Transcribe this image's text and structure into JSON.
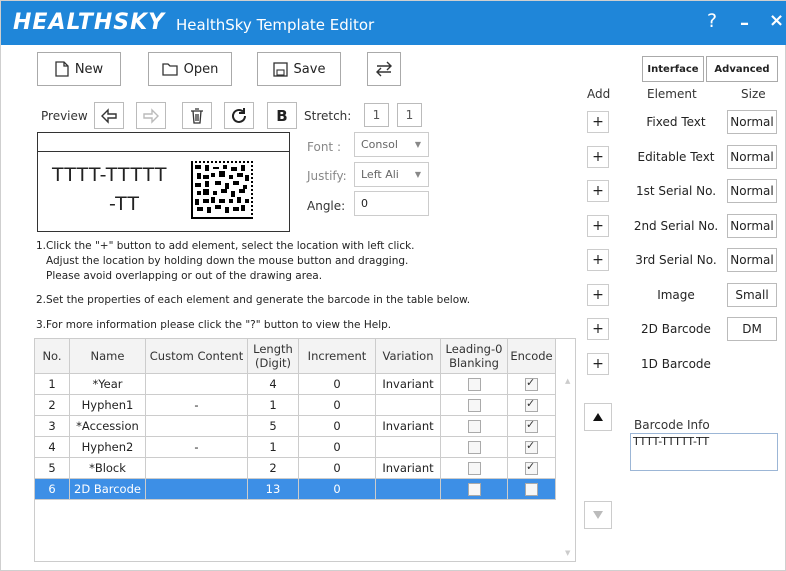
{
  "title": {
    "logo": "HEALTHSKY",
    "app": "HealthSky Template Editor",
    "help": "?",
    "minimize": "–",
    "close": "×"
  },
  "toolbar": {
    "new": "New",
    "open": "Open",
    "save": "Save"
  },
  "preview": {
    "label": "Preview",
    "bold": "B",
    "stretch_label": "Stretch:",
    "stretch_x": "1",
    "stretch_y": "1",
    "font_label": "Font :",
    "font_value": "Consol",
    "justify_label": "Justify:",
    "justify_value": "Left Ali",
    "angle_label": "Angle:",
    "angle_value": "0",
    "text_line1": "TTTT-TTTTT",
    "text_line2": "-TT"
  },
  "instructions": [
    "1.Click the \"+\" button to add element, select the location with left click.",
    "Adjust the location by holding down the mouse button and dragging.",
    "Please avoid overlapping or out of the drawing area.",
    "2.Set the properties of each element and generate the barcode in the table below.",
    "3.For more information please click the \"?\" button to view the Help."
  ],
  "table": {
    "headers": {
      "no": "No.",
      "name": "Name",
      "custom": "Custom Content",
      "length": "Length (Digit)",
      "increment": "Increment",
      "variation": "Variation",
      "leading": "Leading-0 Blanking",
      "encode": "Encode"
    },
    "rows": [
      {
        "no": "1",
        "name": "*Year",
        "custom": "",
        "length": "4",
        "increment": "0",
        "variation": "Invariant",
        "leading": false,
        "encode": true
      },
      {
        "no": "2",
        "name": "Hyphen1",
        "custom": "-",
        "length": "1",
        "increment": "0",
        "variation": "",
        "leading": false,
        "encode": true
      },
      {
        "no": "3",
        "name": "*Accession",
        "custom": "",
        "length": "5",
        "increment": "0",
        "variation": "Invariant",
        "leading": false,
        "encode": true
      },
      {
        "no": "4",
        "name": "Hyphen2",
        "custom": "-",
        "length": "1",
        "increment": "0",
        "variation": "",
        "leading": false,
        "encode": true
      },
      {
        "no": "5",
        "name": "*Block",
        "custom": "",
        "length": "2",
        "increment": "0",
        "variation": "Invariant",
        "leading": false,
        "encode": true
      },
      {
        "no": "6",
        "name": "2D Barcode",
        "custom": "",
        "length": "13",
        "increment": "0",
        "variation": "",
        "leading": false,
        "encode": false
      }
    ],
    "selected_row": "6"
  },
  "right": {
    "interface": "Interface",
    "advanced": "Advanced",
    "col_add": "Add",
    "col_element": "Element",
    "col_size": "Size",
    "plus": "+",
    "elements": [
      {
        "name": "Fixed Text",
        "size": "Normal"
      },
      {
        "name": "Editable Text",
        "size": "Normal"
      },
      {
        "name": "1st Serial No.",
        "size": "Normal"
      },
      {
        "name": "2nd Serial No.",
        "size": "Normal"
      },
      {
        "name": "3rd Serial No.",
        "size": "Normal"
      },
      {
        "name": "Image",
        "size": "Small"
      },
      {
        "name": "2D Barcode",
        "size": "DM"
      },
      {
        "name": "1D Barcode",
        "size": ""
      }
    ],
    "barcode_info_label": "Barcode Info",
    "barcode_info_value": "TTTT-TTTTT-TT"
  },
  "colors": {
    "titlebar": "#1f86d9",
    "selection": "#3d8fe6"
  }
}
